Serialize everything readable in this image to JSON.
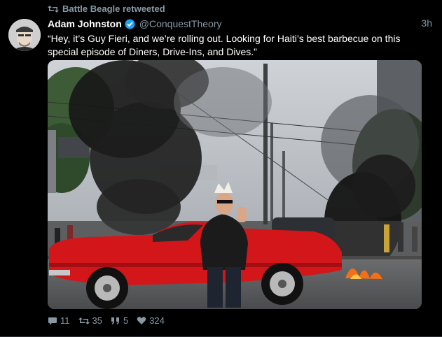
{
  "retweet": {
    "label": "Battle Beagle retweeted",
    "icon": "retweet-icon"
  },
  "author": {
    "name": "Adam Johnston",
    "handle": "@ConquestTheory",
    "verified": true
  },
  "time": "3h",
  "text": "“Hey, it’s Guy Fieri, and we’re rolling out. Looking for Haiti’s best barbecue on this special episode of Diners, Drive-Ins, and Dives.”",
  "actions": {
    "replies": "11",
    "retweets": "35",
    "quotes": "5",
    "likes": "324"
  },
  "colors": {
    "accent": "#1da1f2",
    "muted": "#8899a6",
    "car_red": "#d3161a"
  }
}
